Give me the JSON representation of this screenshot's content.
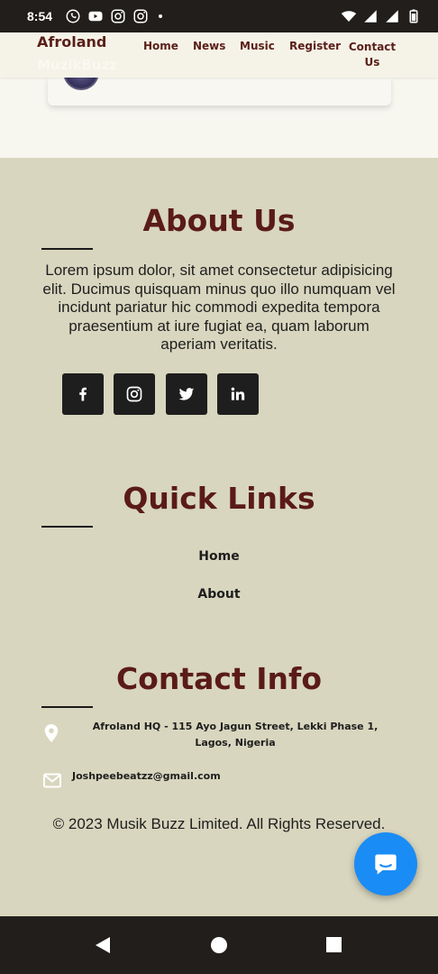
{
  "status_bar": {
    "time": "8:54",
    "left_icons": [
      "whatsapp-icon",
      "youtube-icon",
      "instagram-icon",
      "instagram-icon"
    ],
    "right_icons": [
      "wifi-icon",
      "signal-icon",
      "signal-icon",
      "battery-icon"
    ]
  },
  "nav": {
    "brand": "Afroland",
    "brand_sub": "MuzikBuzz",
    "links": [
      "Home",
      "News",
      "Music",
      "Register",
      "Contact Us"
    ]
  },
  "about": {
    "title": "About Us",
    "text": "Lorem ipsum dolor, sit amet consectetur adipisicing elit. Ducimus quisquam minus quo illo numquam vel incidunt pariatur hic commodi expedita tempora praesentium at iure fugiat ea, quam laborum aperiam veritatis.",
    "social": [
      "facebook-icon",
      "instagram-icon",
      "twitter-icon",
      "linkedin-icon"
    ]
  },
  "quick_links": {
    "title": "Quick Links",
    "links": [
      "Home",
      "About"
    ]
  },
  "contact": {
    "title": "Contact Info",
    "address": "Afroland HQ - 115 Ayo Jagun Street, Lekki Phase 1, Lagos, Nigeria",
    "email": "Joshpeebeatzz@gmail.com"
  },
  "copyright": "© 2023 Musik Buzz Limited. All Rights Reserved.",
  "colors": {
    "heading": "#5a1b17",
    "footer_bg": "#d8d6be",
    "fab": "#1a8cf5"
  }
}
